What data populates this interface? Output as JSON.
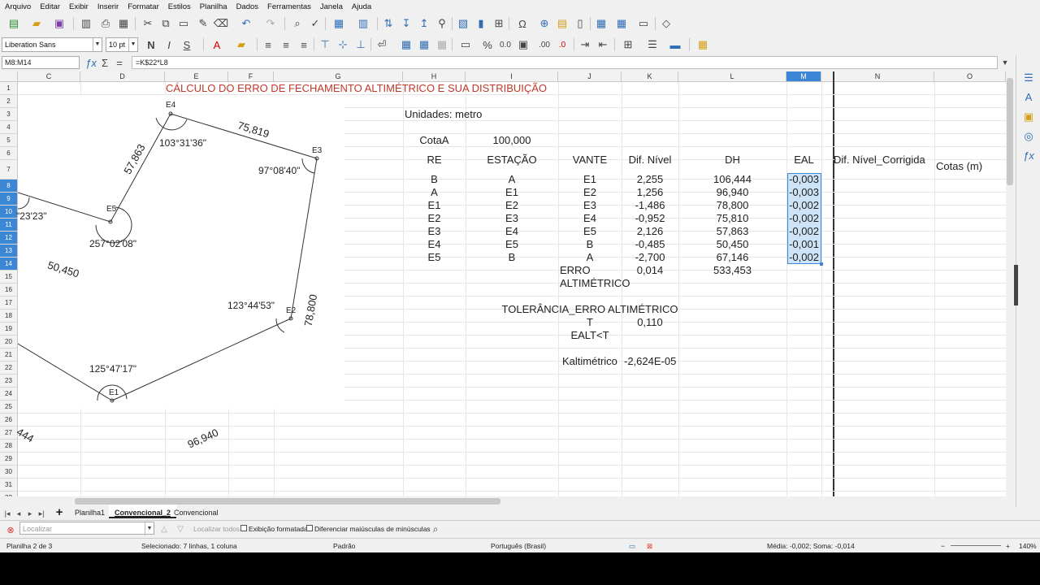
{
  "menu": [
    "Arquivo",
    "Editar",
    "Exibir",
    "Inserir",
    "Formatar",
    "Estilos",
    "Planilha",
    "Dados",
    "Ferramentas",
    "Janela",
    "Ajuda"
  ],
  "toolbar2": {
    "font_name": "Liberation Sans",
    "font_size": "10 pt"
  },
  "formula_bar": {
    "name_box": "M8:M14",
    "formula": "=K$22*L8"
  },
  "columns": [
    "C",
    "D",
    "E",
    "F",
    "G",
    "H",
    "I",
    "J",
    "K",
    "L",
    "M",
    "N",
    "O"
  ],
  "selected_column": "M",
  "rows": [
    "1",
    "2",
    "3",
    "4",
    "5",
    "6",
    "7",
    "8",
    "9",
    "10",
    "11",
    "12",
    "13",
    "14",
    "15",
    "16",
    "17",
    "18",
    "19",
    "20",
    "21",
    "22",
    "23",
    "24",
    "25",
    "26",
    "27",
    "28",
    "29",
    "30",
    "31",
    "32"
  ],
  "selected_rows": [
    "8",
    "9",
    "10",
    "11",
    "12",
    "13",
    "14"
  ],
  "sheet": {
    "title": "CÁLCULO DO ERRO DE FECHAMENTO ALTIMÉTRICO E SUA DISTRIBUIÇÃO",
    "units": "Unidades: metro",
    "cota_label": "CotaA",
    "cota_value": "100,000",
    "headers": [
      "RE",
      "ESTAÇÃO",
      "VANTE",
      "Dif. Nível",
      "DH",
      "EAL",
      "Dif. Nível_Corrigida",
      "Cotas (m)"
    ],
    "table": [
      [
        "B",
        "A",
        "E1",
        "2,255",
        "106,444",
        "-0,003"
      ],
      [
        "A",
        "E1",
        "E2",
        "1,256",
        "96,940",
        "-0,003"
      ],
      [
        "E1",
        "E2",
        "E3",
        "-1,486",
        "78,800",
        "-0,002"
      ],
      [
        "E2",
        "E3",
        "E4",
        "-0,952",
        "75,810",
        "-0,002"
      ],
      [
        "E3",
        "E4",
        "E5",
        "2,126",
        "57,863",
        "-0,002"
      ],
      [
        "E4",
        "E5",
        "B",
        "-0,485",
        "50,450",
        "-0,001"
      ],
      [
        "E5",
        "B",
        "A",
        "-2,700",
        "67,146",
        "-0,002"
      ]
    ],
    "erro_label_1": "ERRO",
    "erro_label_2": "ALTIMÉTRICO",
    "erro_value": "0,014",
    "dh_sum": "533,453",
    "tolerancia": "TOLERÂNCIA_ERRO ALTIMÉTRICO",
    "t_label": "T",
    "t_value": "0,110",
    "ealt": "EALT<T",
    "k_label": "Kaltimétrico",
    "k_value": "-2,624E-05"
  },
  "sketch": {
    "labels": {
      "e4": "E4",
      "e3": "E3",
      "e5": "E5",
      "e2": "E2",
      "e1": "E1",
      "d_75819": "75,819",
      "d_57863": "57,863",
      "d_50450": "50,450",
      "d_78800": "78,800",
      "d_96940": "96,940",
      "d_444": "444",
      "a_e4": "103°31'36\"",
      "a_e3": "97°08'40\"",
      "a_b": "\"23'23\"",
      "a_e5": "257°02'08\"",
      "a_e2": "123°44'53\"",
      "a_e1": "125°47'17\""
    }
  },
  "tabs": [
    "Planilha1",
    "Convencional_2",
    "Convencional"
  ],
  "active_tab": "Convencional_2",
  "findbar": {
    "placeholder": "Localizar",
    "find_all": "Localizar todos",
    "formatted": "Exibição formatada",
    "match_case": "Diferenciar maiúsculas de minúsculas"
  },
  "status": {
    "sheet": "Planilha 2 de 3",
    "selection": "Selecionado: 7 linhas, 1 coluna",
    "style": "Padrão",
    "lang": "Português (Brasil)",
    "summary": "Média: -0,002; Soma: -0,014",
    "zoom": "140%"
  },
  "colors": {
    "accent": "#3c86d6",
    "title": "#c0392b"
  }
}
